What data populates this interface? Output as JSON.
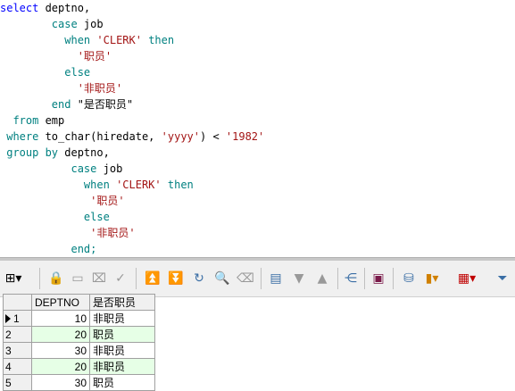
{
  "editor": {
    "lines": [
      {
        "indent": "",
        "parts": [
          {
            "t": "select",
            "c": "kw"
          },
          {
            "t": " deptno,",
            "c": "plain"
          }
        ]
      },
      {
        "indent": "        ",
        "parts": [
          {
            "t": "case",
            "c": "kw2"
          },
          {
            "t": " job",
            "c": "plain"
          }
        ]
      },
      {
        "indent": "          ",
        "parts": [
          {
            "t": "when",
            "c": "kw2"
          },
          {
            "t": " ",
            "c": "plain"
          },
          {
            "t": "'CLERK'",
            "c": "str"
          },
          {
            "t": " ",
            "c": "plain"
          },
          {
            "t": "then",
            "c": "kw2"
          }
        ]
      },
      {
        "indent": "            ",
        "parts": [
          {
            "t": "'职员'",
            "c": "str"
          }
        ]
      },
      {
        "indent": "          ",
        "parts": [
          {
            "t": "else",
            "c": "kw2"
          }
        ]
      },
      {
        "indent": "            ",
        "parts": [
          {
            "t": "'非职员'",
            "c": "str"
          }
        ]
      },
      {
        "indent": "        ",
        "parts": [
          {
            "t": "end",
            "c": "kw2"
          },
          {
            "t": " \"是否职员\"",
            "c": "plain"
          }
        ]
      },
      {
        "indent": "  ",
        "parts": [
          {
            "t": "from",
            "c": "kw2"
          },
          {
            "t": " emp",
            "c": "plain"
          }
        ]
      },
      {
        "indent": " ",
        "parts": [
          {
            "t": "where",
            "c": "kw2"
          },
          {
            "t": " to_char(hiredate, ",
            "c": "plain"
          },
          {
            "t": "'yyyy'",
            "c": "str"
          },
          {
            "t": ") < ",
            "c": "plain"
          },
          {
            "t": "'1982'",
            "c": "str"
          }
        ]
      },
      {
        "indent": " ",
        "parts": [
          {
            "t": "group by",
            "c": "kw2"
          },
          {
            "t": " deptno,",
            "c": "plain"
          }
        ]
      },
      {
        "indent": "           ",
        "parts": [
          {
            "t": "case",
            "c": "kw2"
          },
          {
            "t": " job",
            "c": "plain"
          }
        ]
      },
      {
        "indent": "             ",
        "parts": [
          {
            "t": "when",
            "c": "kw2"
          },
          {
            "t": " ",
            "c": "plain"
          },
          {
            "t": "'CLERK'",
            "c": "str"
          },
          {
            "t": " ",
            "c": "plain"
          },
          {
            "t": "then",
            "c": "kw2"
          }
        ]
      },
      {
        "indent": "              ",
        "parts": [
          {
            "t": "'职员'",
            "c": "str"
          }
        ]
      },
      {
        "indent": "             ",
        "parts": [
          {
            "t": "else",
            "c": "kw2"
          }
        ]
      },
      {
        "indent": "              ",
        "parts": [
          {
            "t": "'非职员'",
            "c": "str"
          }
        ]
      },
      {
        "indent": "           ",
        "parts": [
          {
            "t": "end;",
            "c": "kw2"
          }
        ]
      }
    ]
  },
  "grid": {
    "columns": [
      "DEPTNO",
      "是否职员"
    ],
    "rows": [
      {
        "num": "1",
        "deptno": "10",
        "flag": "非职员"
      },
      {
        "num": "2",
        "deptno": "20",
        "flag": "职员"
      },
      {
        "num": "3",
        "deptno": "30",
        "flag": "非职员"
      },
      {
        "num": "4",
        "deptno": "20",
        "flag": "非职员"
      },
      {
        "num": "5",
        "deptno": "30",
        "flag": "职员"
      }
    ]
  },
  "colors": {
    "keyword": "#0000ff",
    "keyword2": "#008080",
    "string": "#a31515",
    "alt_row": "#e6ffe6"
  }
}
